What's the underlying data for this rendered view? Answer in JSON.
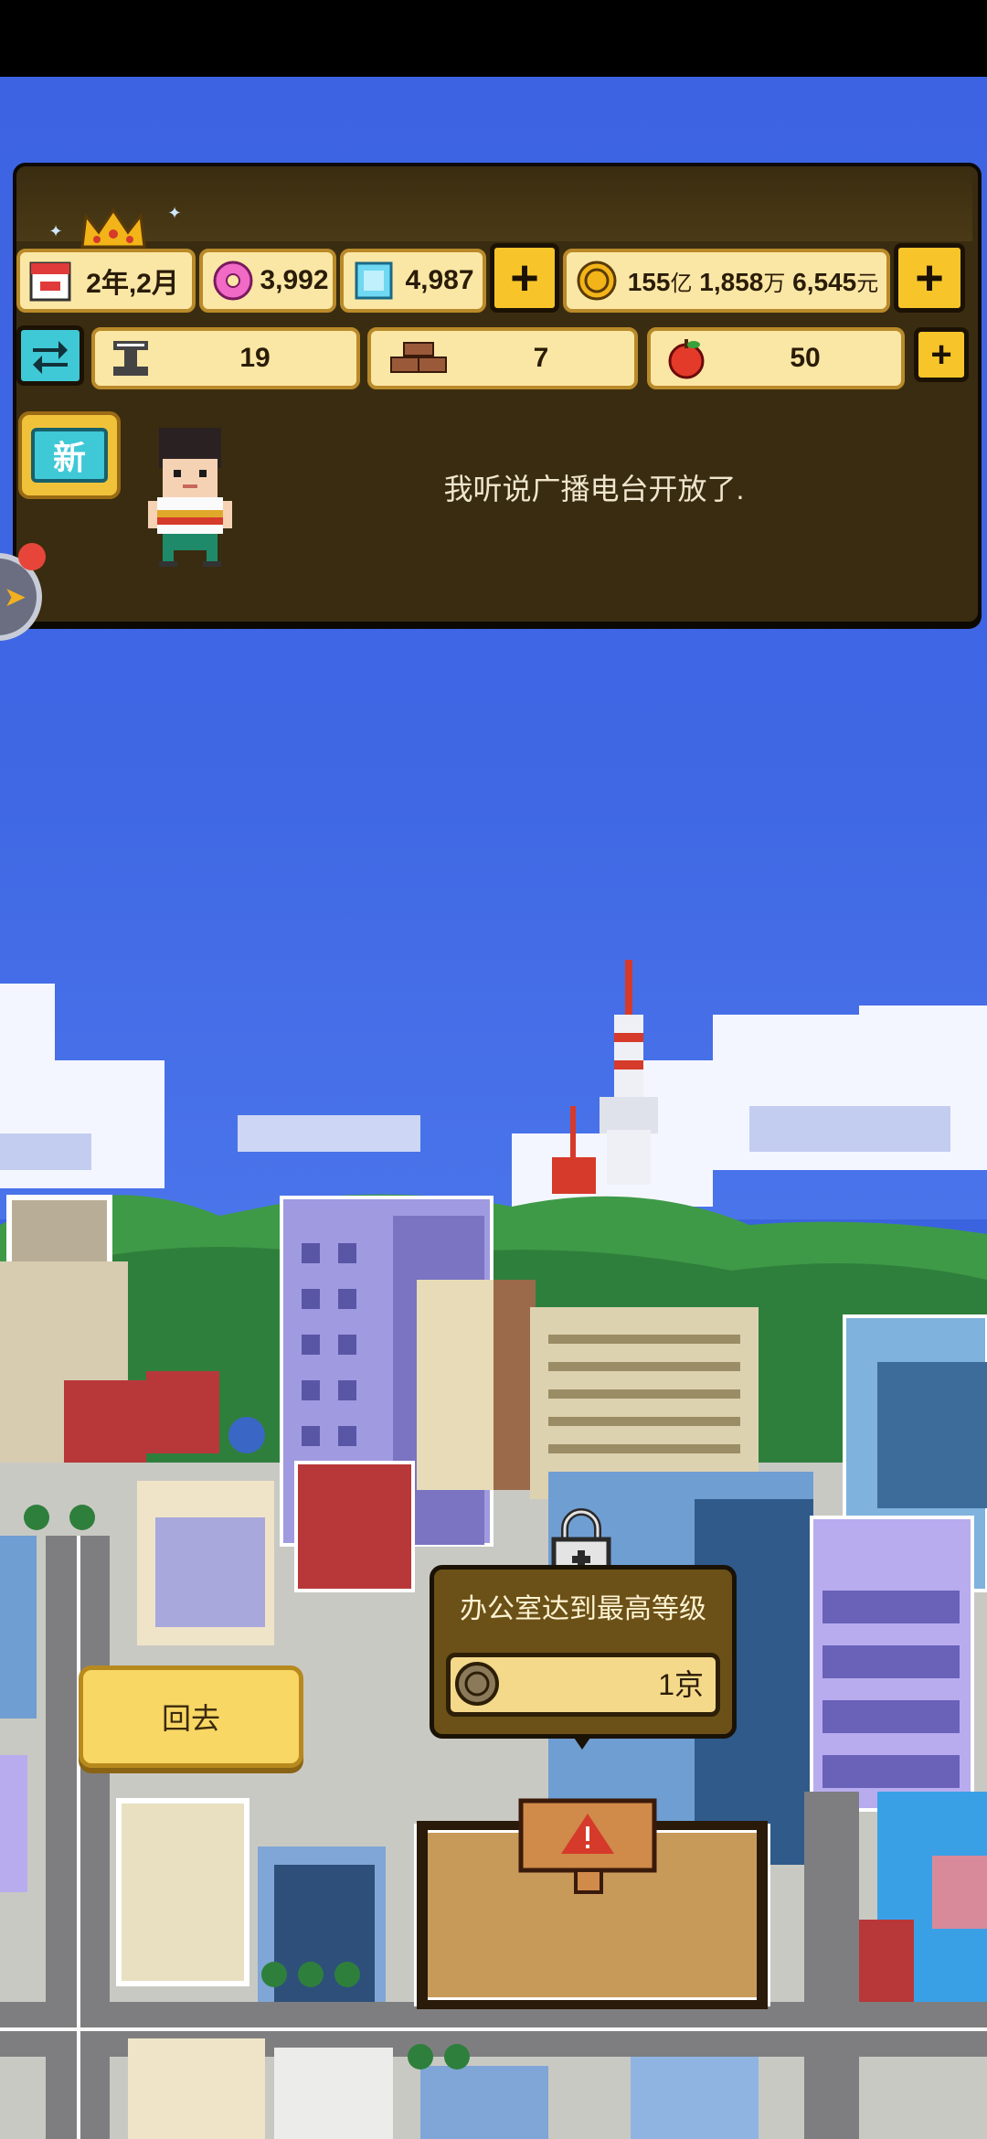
{
  "hud": {
    "date": "2年,2月",
    "gems_pink": "3,992",
    "gems_blue": "4,987",
    "money_yi": "155",
    "money_yi_unit": "亿",
    "money_wan": "1,858",
    "money_wan_unit": "万",
    "money_yuan": "6,545",
    "money_yuan_unit": "元",
    "iron": "19",
    "bricks": "7",
    "apples": "50",
    "plus_symbol": "+"
  },
  "news": {
    "badge": "新",
    "message": "我听说广播电台开放了."
  },
  "popup": {
    "title": "办公室达到最高等级",
    "cost_value": "1",
    "cost_unit": "京"
  },
  "back_button": "回去",
  "colors": {
    "sky": "#3d63e2",
    "hud_bg": "#3a2c10",
    "pill_bg": "#fbe7a5",
    "accent_yellow": "#f7c52a",
    "badge_cyan": "#3fc8d6"
  }
}
